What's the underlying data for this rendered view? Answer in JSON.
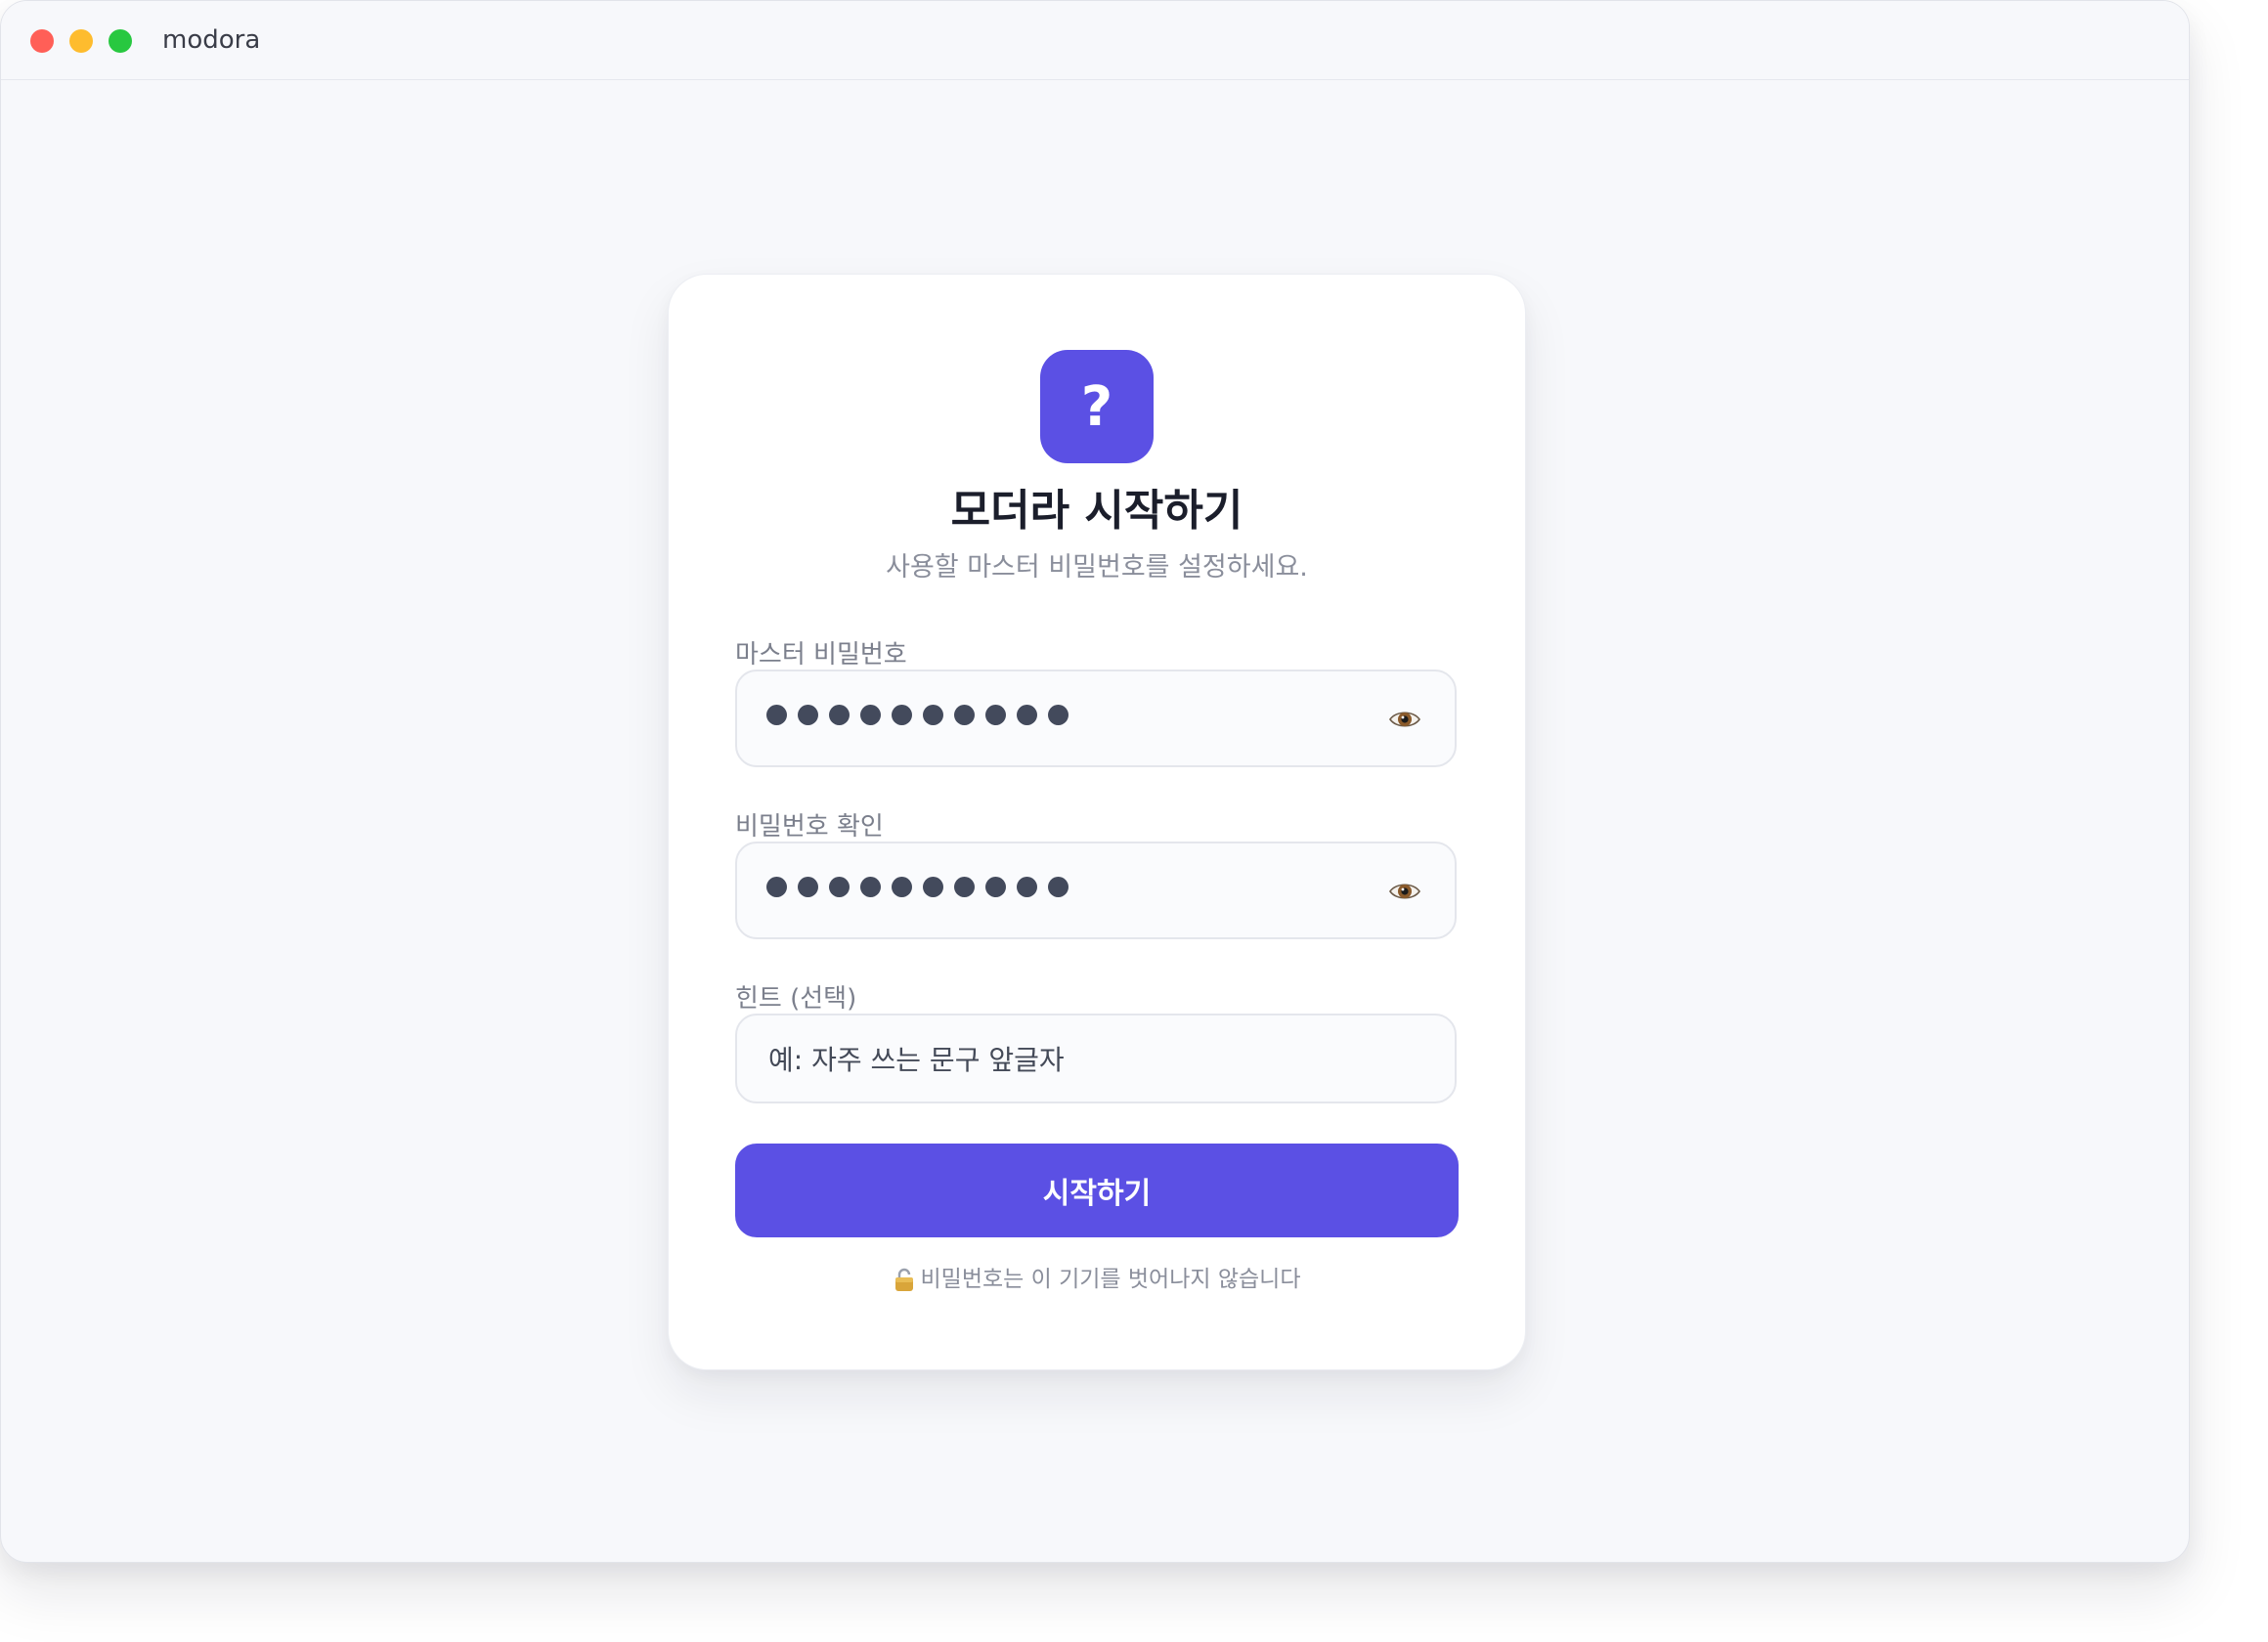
{
  "window": {
    "title": "modora"
  },
  "logo": {
    "glyph": "?",
    "color": "#5b50e4"
  },
  "header": {
    "title": "모더라 시작하기",
    "subtitle": "사용할 마스터 비밀번호를 설정하세요."
  },
  "form": {
    "master_password": {
      "label": "마스터 비밀번호",
      "masked_length": 10,
      "toggle_icon": "eye-icon"
    },
    "confirm_password": {
      "label": "비밀번호 확인",
      "masked_length": 10,
      "toggle_icon": "eye-icon"
    },
    "hint": {
      "label": "힌트 (선택)",
      "placeholder": "예: 자주 쓰는 문구 앞글자",
      "value": ""
    },
    "submit_label": "시작하기"
  },
  "footer": {
    "icon": "lock-icon",
    "note": "비밀번호는 이 기기를 벗어나지 않습니다"
  },
  "colors": {
    "accent": "#5b50e4",
    "traffic_red": "#ff5f57",
    "traffic_yellow": "#febc2e",
    "traffic_green": "#28c840"
  }
}
